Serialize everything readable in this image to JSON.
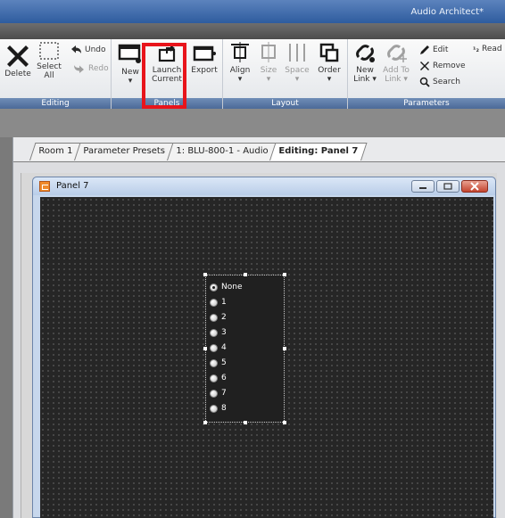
{
  "window": {
    "title": "Audio Architect*"
  },
  "ribbon": {
    "groups": [
      {
        "label": "Editing"
      },
      {
        "label": "Panels"
      },
      {
        "label": "Layout"
      },
      {
        "label": "Parameters"
      }
    ],
    "editing": {
      "delete": "Delete",
      "select_all_1": "Select",
      "select_all_2": "All",
      "undo": "Undo",
      "redo": "Redo"
    },
    "panels": {
      "new": "New",
      "launch_current_1": "Launch",
      "launch_current_2": "Current",
      "export": "Export"
    },
    "layout": {
      "align": "Align",
      "size": "Size",
      "space": "Space",
      "order": "Order"
    },
    "parameters": {
      "new_link_1": "New",
      "new_link_2": "Link",
      "add_to_link_1": "Add To",
      "add_to_link_2": "Link",
      "edit": "Edit",
      "remove": "Remove",
      "search": "Search",
      "read": "Read"
    }
  },
  "tabs": [
    {
      "label": "Room 1"
    },
    {
      "label": "Parameter Presets"
    },
    {
      "label": "1: BLU-800-1 - Audio"
    },
    {
      "label": "Editing: Panel 7"
    }
  ],
  "panel": {
    "title": "Panel 7",
    "selector_options": [
      "None",
      "1",
      "2",
      "3",
      "4",
      "5",
      "6",
      "7",
      "8"
    ],
    "selected_option": "None"
  },
  "colors": {
    "highlight": "#e8141b",
    "canvas": "#262626",
    "group_label": "#5a78a5"
  }
}
